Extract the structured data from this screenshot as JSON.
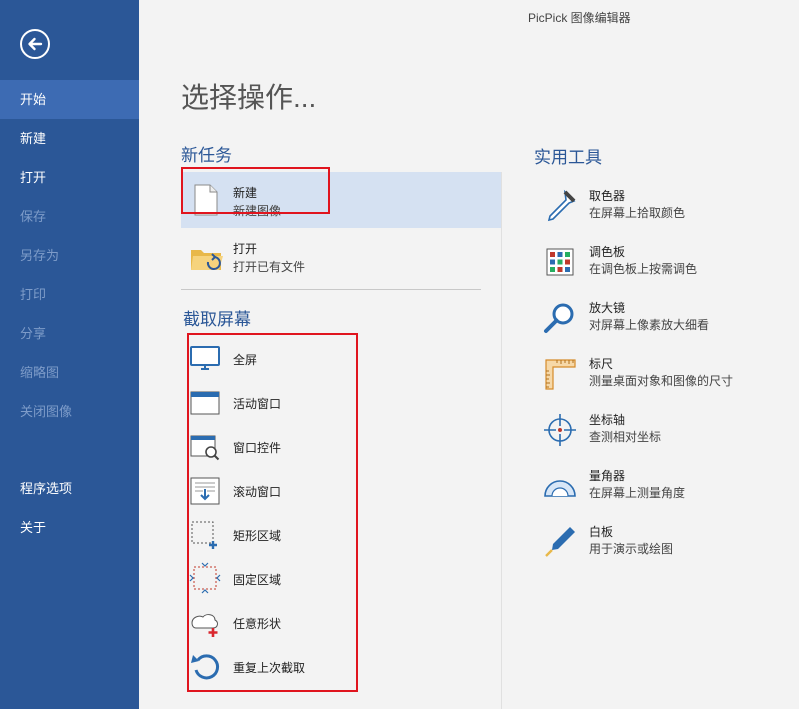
{
  "window": {
    "title": "PicPick 图像编辑器"
  },
  "sidebar": {
    "items": [
      {
        "label": "开始"
      },
      {
        "label": "新建"
      },
      {
        "label": "打开"
      },
      {
        "label": "保存"
      },
      {
        "label": "另存为"
      },
      {
        "label": "打印"
      },
      {
        "label": "分享"
      },
      {
        "label": "缩略图"
      },
      {
        "label": "关闭图像"
      }
    ],
    "bottom_items": [
      {
        "label": "程序选项"
      },
      {
        "label": "关于"
      }
    ]
  },
  "main": {
    "title": "选择操作...",
    "new_tasks": {
      "heading": "新任务",
      "items": [
        {
          "label": "新建",
          "desc": "新建图像"
        },
        {
          "label": "打开",
          "desc": "打开已有文件"
        }
      ]
    },
    "capture": {
      "heading": "截取屏幕",
      "items": [
        {
          "label": "全屏"
        },
        {
          "label": "活动窗口"
        },
        {
          "label": "窗口控件"
        },
        {
          "label": "滚动窗口"
        },
        {
          "label": "矩形区域"
        },
        {
          "label": "固定区域"
        },
        {
          "label": "任意形状"
        },
        {
          "label": "重复上次截取"
        }
      ]
    },
    "tools": {
      "heading": "实用工具",
      "items": [
        {
          "label": "取色器",
          "desc": "在屏幕上拾取颜色"
        },
        {
          "label": "调色板",
          "desc": "在调色板上按需调色"
        },
        {
          "label": "放大镜",
          "desc": "对屏幕上像素放大细看"
        },
        {
          "label": "标尺",
          "desc": "测量桌面对象和图像的尺寸"
        },
        {
          "label": "坐标轴",
          "desc": "查测相对坐标"
        },
        {
          "label": "量角器",
          "desc": "在屏幕上测量角度"
        },
        {
          "label": "白板",
          "desc": "用于演示或绘图"
        }
      ]
    }
  },
  "colors": {
    "sidebar": "#2b5797",
    "sidebar_active": "#3d6bb3",
    "accent": "#2b5797",
    "highlight_box": "#e0141e"
  }
}
